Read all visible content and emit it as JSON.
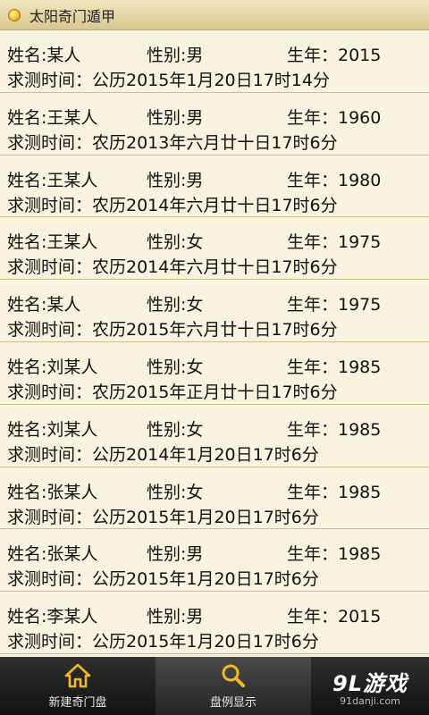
{
  "app": {
    "title": "太阳奇门遁甲"
  },
  "records": [
    {
      "name": "姓名:某人",
      "gender": "性别:男",
      "year": "生年：2015",
      "time": "求测时间：公历2015年1月20日17时14分"
    },
    {
      "name": "姓名:王某人",
      "gender": "性别:男",
      "year": "生年：1960",
      "time": "求测时间：农历2013年六月廿十日17时6分"
    },
    {
      "name": "姓名:王某人",
      "gender": "性别:男",
      "year": "生年：1980",
      "time": "求测时间：农历2014年六月廿十日17时6分"
    },
    {
      "name": "姓名:王某人",
      "gender": "性别:女",
      "year": "生年：1975",
      "time": "求测时间：农历2014年六月廿十日17时6分"
    },
    {
      "name": "姓名:某人",
      "gender": "性别:女",
      "year": "生年：1975",
      "time": "求测时间：农历2015年六月廿十日17时6分"
    },
    {
      "name": "姓名:刘某人",
      "gender": "性别:女",
      "year": "生年：1985",
      "time": "求测时间：农历2015年正月廿十日17时6分"
    },
    {
      "name": "姓名:刘某人",
      "gender": "性别:女",
      "year": "生年：1985",
      "time": "求测时间：公历2014年1月20日17时6分"
    },
    {
      "name": "姓名:张某人",
      "gender": "性别:女",
      "year": "生年：1985",
      "time": "求测时间：公历2015年1月20日17时6分"
    },
    {
      "name": "姓名:张某人",
      "gender": "性别:男",
      "year": "生年：1985",
      "time": "求测时间：公历2015年1月20日17时6分"
    },
    {
      "name": "姓名:李某人",
      "gender": "性别:男",
      "year": "生年：2015",
      "time": "求测时间：公历2015年1月20日17时6分"
    }
  ],
  "tabs": [
    {
      "label": "新建奇门盘",
      "icon": "home-icon"
    },
    {
      "label": "盘例显示",
      "icon": "search-icon",
      "selected": true
    }
  ],
  "watermark": {
    "brand": "9L游戏",
    "url": "91danji.com"
  },
  "colors": {
    "background": "#f6f1dc",
    "tab_bar": "#1a1a1a",
    "icon_accent": "#f2b820"
  }
}
